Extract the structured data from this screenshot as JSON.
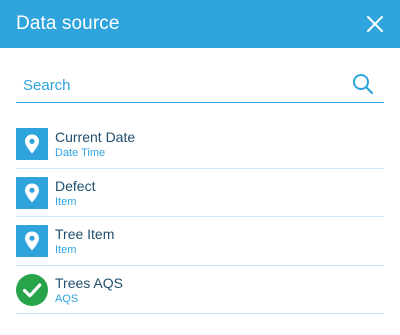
{
  "header": {
    "title": "Data source",
    "close_icon": "close-icon",
    "background": "#2ea3dc"
  },
  "search": {
    "placeholder": "Search",
    "value": "",
    "icon": "search-icon"
  },
  "items": [
    {
      "title": "Current Date",
      "subtitle": "Date Time",
      "icon": "map-pin-icon",
      "icon_color": "#2ea3dc"
    },
    {
      "title": "Defect",
      "subtitle": "Item",
      "icon": "map-pin-icon",
      "icon_color": "#2ea3dc"
    },
    {
      "title": "Tree Item",
      "subtitle": "Item",
      "icon": "map-pin-icon",
      "icon_color": "#2ea3dc"
    },
    {
      "title": "Trees AQS",
      "subtitle": "AQS",
      "icon": "check-circle-icon",
      "icon_color": "#27a34a"
    }
  ]
}
